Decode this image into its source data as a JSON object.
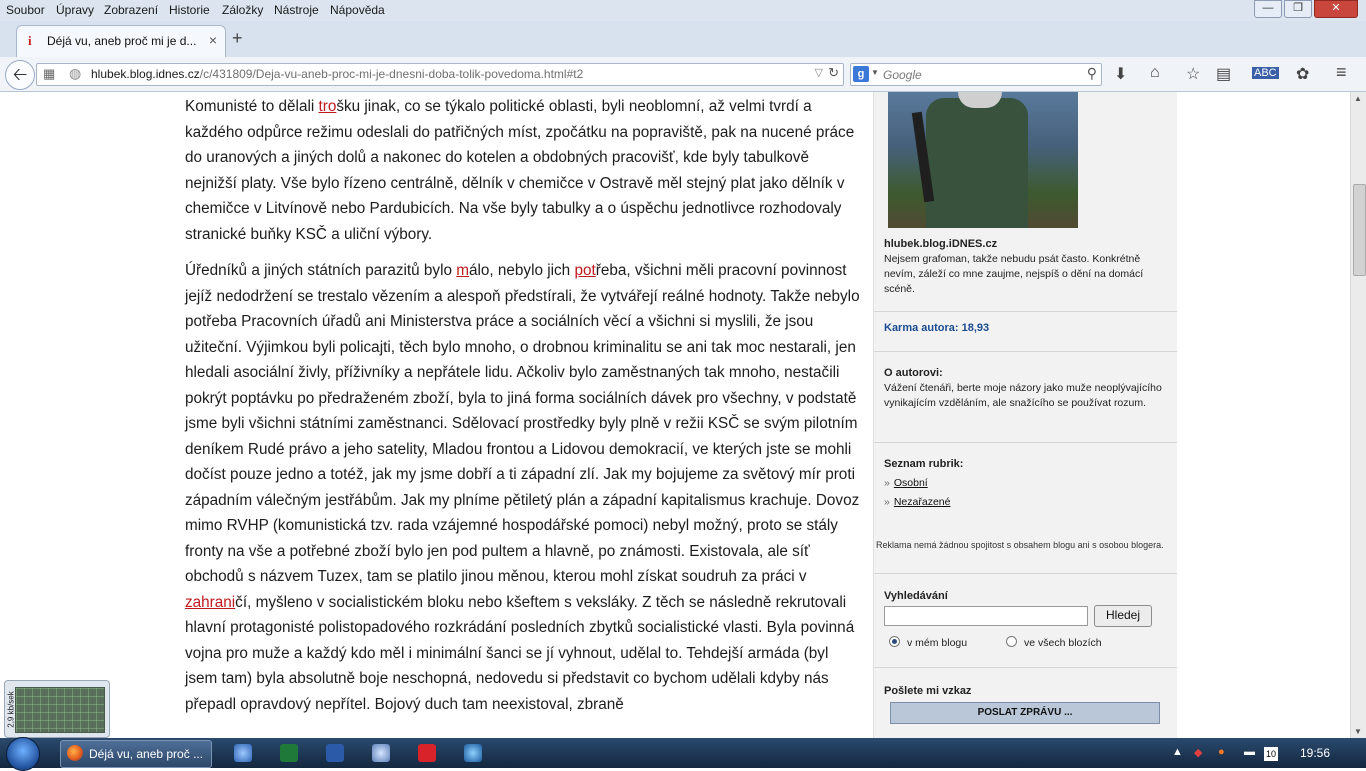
{
  "menu": [
    "Soubor",
    "Úpravy",
    "Zobrazení",
    "Historie",
    "Záložky",
    "Nástroje",
    "Nápověda"
  ],
  "window_controls": {
    "minimize": "—",
    "maximize": "❐",
    "close": "✕"
  },
  "tab": {
    "title": "Déjá vu, aneb proč mi je d...",
    "close": "×",
    "new_tab": "+"
  },
  "navbar": {
    "url_host": "hlubek.blog.idnes.cz",
    "url_path": "/c/431809/Deja-vu-aneb-proc-mi-je-dnesni-doba-tolik-povedoma.html#t2",
    "search_placeholder": "Google"
  },
  "article": {
    "p1": {
      "pre": "Komunisté to dělali ",
      "link": "tro",
      "post": "šku jinak, co se týkalo politické oblasti, byli neoblomní, až velmi tvrdí a každého odpůrce režimu odeslali do patřičných míst, zpočátku na popraviště, pak na nucené práce do uranových a jiných dolů a nakonec do kotelen a obdobných pracovišť, kde byly tabulkově nejnižší platy. Vše bylo řízeno centrálně, dělník v chemičce v Ostravě měl stejný plat jako dělník v chemičce v Litvínově nebo Pardubicích. Na vše byly tabulky a o úspěchu jednotlivce rozhodovaly stranické buňky KSČ a uliční výbory."
    },
    "p2": {
      "t1": "Úředníků a jiných státních parazitů bylo ",
      "l1": "m",
      "t2": "álo, nebylo jich ",
      "l2": "pot",
      "t3": "řeba, všichni měli pracovní povinnost jejíž nedodržení se trestalo vězením a alespoň předstírali, že vytvářejí reálné hodnoty. Takže nebylo potřeba Pracovních úřadů ani Ministerstva práce a sociálních věcí a všichni si myslili, že jsou užiteční. Výjimkou byli policajti, těch bylo mnoho, o drobnou kriminalitu se ani tak moc nestarali, jen hledali asociální živly, příživníky a nepřátele lidu. Ačkoliv bylo zaměstnaných tak mnoho, nestačili pokrýt poptávku po předraženém zboží, byla to jiná forma sociálních dávek pro všechny, v podstatě jsme byli všichni státními zaměstnanci. Sdělovací prostředky byly plně v režii KSČ se svým pilotním deníkem Rudé právo a jeho satelity, Mladou frontou a Lidovou demokracií, ve kterých jste se mohli dočíst pouze jedno a totéž, jak my jsme dobří a ti západní zlí. Jak my bojujeme za světový mír proti západním válečným jestřábům. Jak my plníme pětiletý plán a západní kapitalismus krachuje. Dovoz mimo RVHP (komunistická tzv. rada vzájemné hospodářské pomoci) nebyl možný, proto se stály fronty na vše a potřebné zboží bylo jen pod pultem a hlavně, po známosti. Existovala, ale síť obchodů s názvem Tuzex, tam se platilo jinou měnou, kterou mohl získat soudruh za práci v ",
      "l3": "zahrani",
      "t4": "čí, myšleno v socialistickém bloku nebo kšeftem s veksláky. Z těch se následně rekrutovali hlavní protagonisté polistopadového rozkrádání posledních zbytků socialistické vlasti. Byla povinná vojna pro muže a každý kdo měl i minimální šanci se jí vyhnout, udělal to. Tehdejší armáda (byl jsem tam) byla absolutně boje neschopná, nedovedu si představit co bychom udělali kdyby nás přepadl opravdový nepřítel. Bojový duch tam neexistoval, zbraně"
    }
  },
  "sidebar": {
    "blog_name": "hlubek.blog.iDNES.cz",
    "blog_desc": "Nejsem grafoman, takže nebudu psát často. Konkrétně nevím, záleží co mne zaujme, nejspíš o dění na domácí scéně.",
    "karma": "Karma autora: 18,93",
    "about_title": "O autorovi:",
    "about_text": "Vážení čtenáři, berte moje názory jako muže neoplývajícího vynikajícím vzděláním, ale snažícího se používat rozum.",
    "rubrics_title": "Seznam rubrik:",
    "rubrics": [
      "Osobní",
      "Nezařazené"
    ],
    "ad_note": "Reklama nemá žádnou spojitost s obsahem blogu ani s osobou blogera.",
    "search_title": "Vyhledávání",
    "search_button": "Hledej",
    "radio_my": "v mém blogu",
    "radio_all": "ve všech blozích",
    "message_title": "Pošlete mi vzkaz",
    "send_button": "POSLAT ZPRÁVU ..."
  },
  "widget": {
    "label": "2,9 kb/sek"
  },
  "taskbar": {
    "firefox_label": "Déjá vu, aneb proč ...",
    "time": "19:56",
    "calendar_day": "10"
  }
}
